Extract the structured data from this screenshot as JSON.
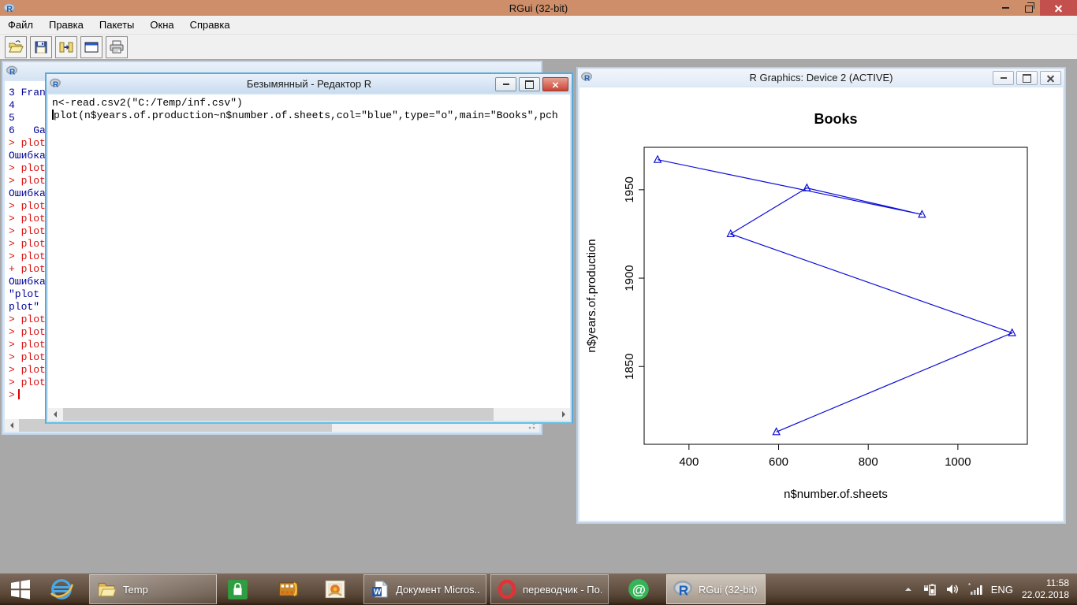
{
  "window": {
    "title": "RGui (32-bit)"
  },
  "menu": {
    "items": [
      "Файл",
      "Правка",
      "Пакеты",
      "Окна",
      "Справка"
    ]
  },
  "toolbar": {
    "buttons": [
      {
        "name": "open-script-button",
        "icon": "open-icon"
      },
      {
        "name": "save-button",
        "icon": "save-icon"
      },
      {
        "name": "copy-paste-button",
        "icon": "copy-paste-icon"
      },
      {
        "name": "windows-button",
        "icon": "window-icon"
      },
      {
        "name": "print-button",
        "icon": "print-icon"
      }
    ]
  },
  "colors": {
    "command": "#dd1111",
    "output": "#000096",
    "plot_line": "#0d0dd8",
    "titlebar": "#cd8e69",
    "close_button": "#c4504e"
  },
  "console": {
    "lines": [
      {
        "text": "3 Fran",
        "kind": "output"
      },
      {
        "text": "4",
        "kind": "output"
      },
      {
        "text": "5",
        "kind": "output"
      },
      {
        "text": "6   Ga",
        "kind": "output"
      },
      {
        "text": "> plot",
        "kind": "command"
      },
      {
        "text": "Ошибка",
        "kind": "output"
      },
      {
        "text": "> plot",
        "kind": "command"
      },
      {
        "text": "> plot",
        "kind": "command"
      },
      {
        "text": "Ошибка",
        "kind": "output"
      },
      {
        "text": "> plot",
        "kind": "command"
      },
      {
        "text": "> plot",
        "kind": "command"
      },
      {
        "text": "> plot",
        "kind": "command"
      },
      {
        "text": "> plot",
        "kind": "command"
      },
      {
        "text": "> plot",
        "kind": "command"
      },
      {
        "text": "+ plot",
        "kind": "command"
      },
      {
        "text": "Ошибка",
        "kind": "output"
      },
      {
        "text": "\"plot",
        "kind": "output"
      },
      {
        "text": "plot\"",
        "kind": "output"
      },
      {
        "text": "> plot",
        "kind": "command"
      },
      {
        "text": "> plot",
        "kind": "command"
      },
      {
        "text": "> plot",
        "kind": "command"
      },
      {
        "text": "> plot",
        "kind": "command"
      },
      {
        "text": "> plot",
        "kind": "command"
      },
      {
        "text": "> plot",
        "kind": "command"
      },
      {
        "text": ">",
        "kind": "command",
        "cursor": true
      }
    ]
  },
  "editor": {
    "title": "Безымянный - Редактор R",
    "cursor_line": 1,
    "lines": [
      "n<-read.csv2(\"C:/Temp/inf.csv\")",
      "plot(n$years.of.production~n$number.of.sheets,col=\"blue\",type=\"o\",main=\"Books\",pch"
    ]
  },
  "graphics": {
    "title": "R Graphics: Device 2 (ACTIVE)"
  },
  "chart_data": {
    "type": "line",
    "title": "Books",
    "xlabel": "n$number.of.sheets",
    "ylabel": "n$years.of.production",
    "points": [
      [
        330,
        1967
      ],
      [
        920,
        1936
      ],
      [
        663,
        1951
      ],
      [
        493,
        1925
      ],
      [
        1121,
        1869
      ],
      [
        595,
        1813
      ]
    ],
    "xticks": [
      400,
      600,
      800,
      1000
    ],
    "yticks": [
      1850,
      1900,
      1950
    ],
    "xlim": [
      300,
      1155
    ],
    "ylim": [
      1806,
      1974
    ],
    "marker": "open-triangle",
    "line_color": "#0d0dd8",
    "grid": false,
    "legend": null
  },
  "taskbar": {
    "items": [
      {
        "name": "start-button",
        "icon": "start-icon"
      },
      {
        "name": "internet-explorer",
        "icon": "ie-icon"
      },
      {
        "name": "temp-folder",
        "icon": "folder-icon",
        "label": "Temp",
        "state": "open"
      },
      {
        "name": "windows-store",
        "icon": "store-icon"
      },
      {
        "name": "movie-maker",
        "icon": "moviemaker-icon"
      },
      {
        "name": "photos-app",
        "icon": "photos-icon"
      },
      {
        "name": "word-document",
        "icon": "word-icon",
        "label": "Документ Micros..."
      },
      {
        "name": "opera-translator",
        "icon": "opera-icon",
        "label": "переводчик - По..."
      },
      {
        "name": "mailru-agent",
        "icon": "mailru-icon"
      },
      {
        "name": "rgui-taskbar",
        "icon": "r-logo-icon",
        "label": "RGui (32-bit)",
        "state": "active"
      }
    ],
    "tray": {
      "lang": "ENG",
      "time": "11:58",
      "date": "22.02.2018"
    }
  }
}
